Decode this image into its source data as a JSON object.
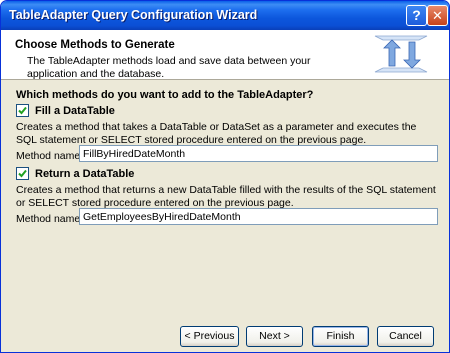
{
  "window": {
    "title": "TableAdapter Query Configuration Wizard"
  },
  "title_buttons": {
    "help": "?",
    "close": "✕"
  },
  "header": {
    "title": "Choose Methods to Generate",
    "description": "The TableAdapter methods load and save data between your application and the database.",
    "icon": "tableadapter-arrows-icon"
  },
  "question": "Which methods do you want to add to the TableAdapter?",
  "fill": {
    "checked": true,
    "label": "Fill a DataTable",
    "description": "Creates a method that takes a DataTable or DataSet as a parameter and executes the SQL statement or SELECT stored procedure entered on the previous page.",
    "method_label": "Method name:",
    "method_value": "FillByHiredDateMonth"
  },
  "return": {
    "checked": true,
    "label": "Return a DataTable",
    "description": "Creates a method that returns a new DataTable filled with the results of the SQL statement or SELECT stored procedure entered on the previous page.",
    "method_label": "Method name:",
    "method_value": "GetEmployeesByHiredDateMonth"
  },
  "buttons": {
    "previous": "< Previous",
    "next": "Next >",
    "finish": "Finish",
    "cancel": "Cancel"
  },
  "colors": {
    "titlebar": "#0B4FD5",
    "dialog_bg": "#ECE9D8",
    "check_mark": "#21A121",
    "input_border": "#7F9DB9"
  }
}
